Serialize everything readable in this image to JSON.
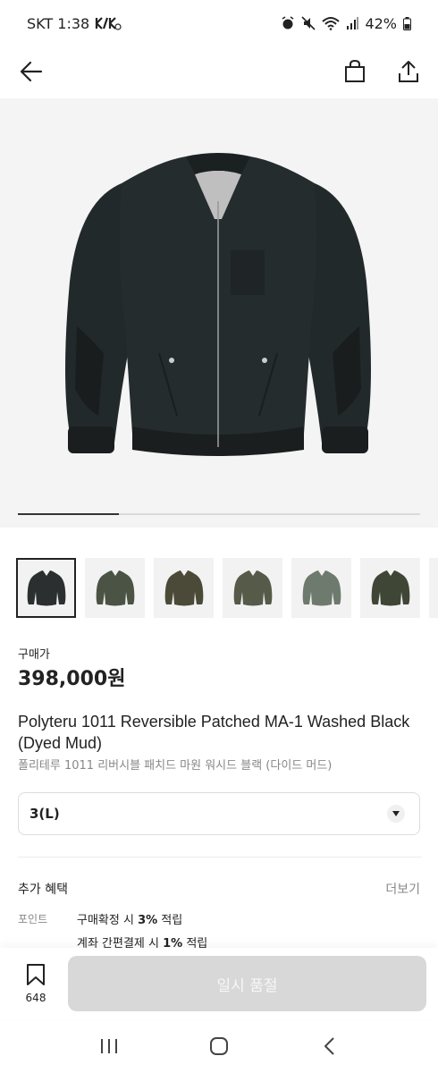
{
  "status_bar": {
    "carrier_time": "SKT 1:38",
    "battery": "42%"
  },
  "header": {
    "back_icon": "back-arrow-icon",
    "cart_icon": "shopping-bag-icon",
    "share_icon": "share-icon"
  },
  "gallery": {
    "progress_fraction": 0.25,
    "thumbnail_count": 7,
    "thumbnail_colors": [
      "#2b2f2f",
      "#4a5344",
      "#4b4a38",
      "#555b48",
      "#6f7a6e",
      "#3f4636",
      "#dddddd"
    ]
  },
  "price": {
    "label": "구매가",
    "value": "398,000원"
  },
  "product": {
    "name": "Polyteru 1011 Reversible Patched MA-1 Washed Black (Dyed Mud)",
    "name_ko": "폴리테루 1011 리버시블 패치드 마원 워시드 블랙 (다이드 머드)"
  },
  "size_select": {
    "value": "3(L)"
  },
  "benefits": {
    "title": "추가 혜택",
    "more": "더보기",
    "points_label": "포인트",
    "line1_pre": "구매확정 시 ",
    "line1_bold": "3%",
    "line1_post": " 적립",
    "line2_pre": "계좌 간편결제 시 ",
    "line2_bold": "1%",
    "line2_post": " 적립"
  },
  "bottom_bar": {
    "wish_count": "648",
    "buy_label": "일시 품절"
  },
  "colors": {
    "disabled_button": "#d8d8d8",
    "text_primary": "#222222",
    "text_secondary": "#888888"
  }
}
